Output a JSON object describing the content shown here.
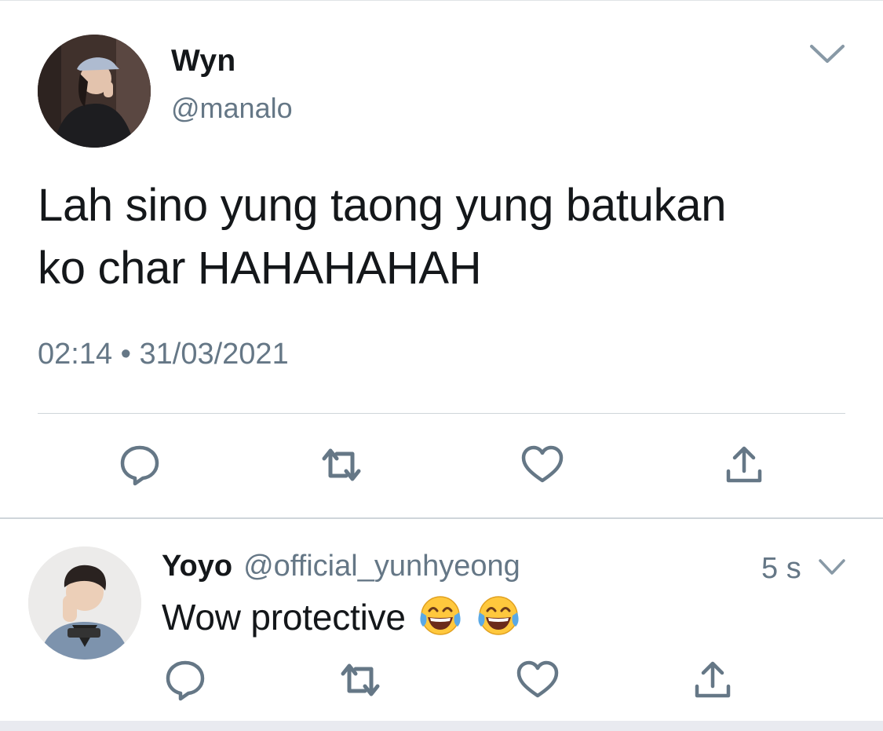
{
  "main_tweet": {
    "author_name": "Wyn",
    "author_handle": "@manalo",
    "text_line1": "Lah sino yung taong yung batukan",
    "text_line2": "ko char HAHAHAHAH",
    "timestamp": "02:14 • 31/03/2021",
    "actions": [
      "reply-icon",
      "retweet-icon",
      "like-icon",
      "share-icon"
    ]
  },
  "reply": {
    "author_name": "Yoyo",
    "author_handle": "@official_yunhyeong",
    "time_ago": "5 s",
    "text": "Wow protective",
    "emojis": [
      "face-with-tears-of-joy",
      "face-with-tears-of-joy"
    ],
    "actions": [
      "reply-icon",
      "retweet-icon",
      "like-icon",
      "share-icon"
    ]
  },
  "colors": {
    "text_primary": "#14171a",
    "text_secondary": "#657786",
    "icon_gray": "#657786",
    "divider": "#cfd5da"
  }
}
